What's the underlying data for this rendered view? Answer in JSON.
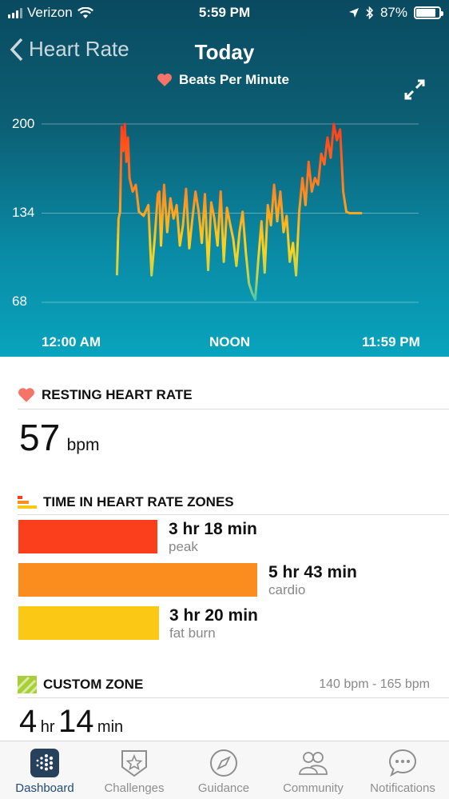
{
  "status_bar": {
    "carrier": "Verizon",
    "time": "5:59 PM",
    "battery": "87%",
    "battery_level": 0.87
  },
  "nav": {
    "back_label": "Heart Rate",
    "title": "Today"
  },
  "chart_data": {
    "type": "line",
    "legend": "Beats Per Minute",
    "y_ticks": [
      "200",
      "134",
      "68"
    ],
    "x_ticks": [
      "12:00 AM",
      "NOON",
      "11:59 PM"
    ],
    "ylim": [
      68,
      200
    ],
    "grid": true,
    "series": [
      {
        "x": [
          4.8,
          4.9,
          5.0,
          5.1,
          5.2,
          5.3,
          5.4,
          5.5,
          5.6,
          5.8,
          6.0,
          6.2,
          6.5,
          6.8,
          7.0,
          7.2,
          7.4,
          7.5,
          7.6,
          7.8,
          8.0,
          8.2,
          8.4,
          8.6,
          8.8,
          9.0,
          9.2,
          9.4,
          9.6,
          9.8,
          10.0,
          10.2,
          10.4,
          10.6,
          10.8,
          11.0,
          11.2,
          11.4,
          11.6,
          11.8,
          12.0,
          12.2,
          12.4,
          12.6,
          12.8,
          13.0,
          13.2,
          13.4,
          13.6,
          13.8,
          14.0,
          14.2,
          14.4,
          14.6,
          14.8,
          15.0,
          15.2,
          15.4,
          15.6,
          15.8,
          16.0,
          16.2,
          16.4,
          16.6,
          16.8,
          17.0,
          17.2,
          17.4,
          17.6,
          17.8,
          18.0,
          18.2,
          18.4,
          18.6,
          18.8,
          19.0,
          19.2,
          19.4,
          19.6,
          19.8,
          20.0,
          20.2,
          20.4
        ],
        "y": [
          88,
          130,
          135,
          198,
          180,
          200,
          172,
          190,
          160,
          150,
          155,
          135,
          132,
          140,
          88,
          115,
          148,
          150,
          110,
          155,
          120,
          145,
          130,
          140,
          110,
          125,
          152,
          108,
          130,
          150,
          135,
          112,
          148,
          92,
          142,
          130,
          110,
          150,
          98,
          138,
          126,
          115,
          95,
          120,
          135,
          105,
          82,
          75,
          70,
          100,
          128,
          90,
          140,
          125,
          155,
          128,
          150,
          120,
          132,
          98,
          112,
          88,
          135,
          160,
          140,
          172,
          150,
          160,
          155,
          178,
          170,
          190,
          175,
          200,
          188,
          196,
          150,
          135,
          134,
          134,
          134,
          134,
          134
        ]
      }
    ]
  },
  "resting": {
    "heading": "RESTING HEART RATE",
    "value": "57",
    "unit": "bpm"
  },
  "zones": {
    "heading": "TIME IN HEART RATE ZONES",
    "items": [
      {
        "time": "3 hr 18 min",
        "name": "peak",
        "color": "#fb3f1d"
      },
      {
        "time": "5 hr 43 min",
        "name": "cardio",
        "color": "#fb8d1f"
      },
      {
        "time": "3 hr 20 min",
        "name": "fat burn",
        "color": "#fcc816"
      }
    ]
  },
  "custom": {
    "heading": "CUSTOM ZONE",
    "range": "140 bpm - 165 bpm",
    "hours": "4",
    "hours_unit": "hr",
    "minutes": "14",
    "minutes_unit": "min"
  },
  "tabs": [
    {
      "label": "Dashboard",
      "icon": "dashboard-icon",
      "active": true
    },
    {
      "label": "Challenges",
      "icon": "star-badge-icon",
      "active": false
    },
    {
      "label": "Guidance",
      "icon": "compass-icon",
      "active": false
    },
    {
      "label": "Community",
      "icon": "people-icon",
      "active": false
    },
    {
      "label": "Notifications",
      "icon": "chat-bubble-icon",
      "active": false
    }
  ]
}
